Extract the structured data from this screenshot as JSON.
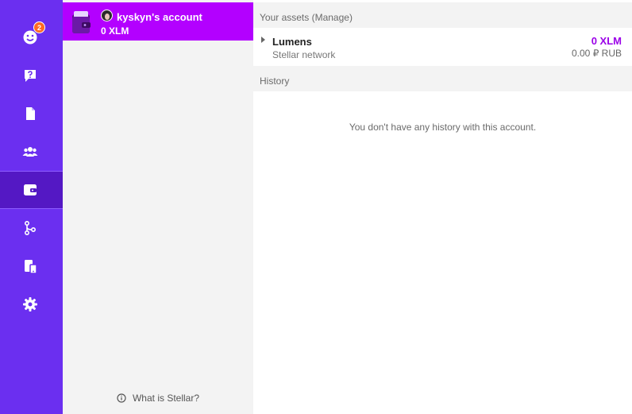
{
  "nav": {
    "items": [
      {
        "name": "chats",
        "icon": "smiley-chat-icon",
        "badge": "2"
      },
      {
        "name": "support",
        "icon": "help-chat-icon"
      },
      {
        "name": "documents",
        "icon": "document-icon"
      },
      {
        "name": "contacts",
        "icon": "group-icon"
      },
      {
        "name": "wallet",
        "icon": "wallet-icon",
        "active": true
      },
      {
        "name": "git",
        "icon": "git-branch-icon"
      },
      {
        "name": "devices",
        "icon": "devices-icon"
      },
      {
        "name": "settings",
        "icon": "gear-icon"
      }
    ],
    "accent": "#6b2ff0"
  },
  "account": {
    "name": "kyskyn's account",
    "balance": "0 XLM",
    "highlight": "#b300ff"
  },
  "footer": {
    "what_is_stellar": "What is Stellar?"
  },
  "assets": {
    "header": "Your assets (Manage)",
    "items": [
      {
        "name": "Lumens",
        "network": "Stellar network",
        "amount": "0 XLM",
        "fiat": "0.00 ₽ RUB"
      }
    ]
  },
  "history": {
    "header": "History",
    "empty_text": "You don't have any history with this account."
  }
}
